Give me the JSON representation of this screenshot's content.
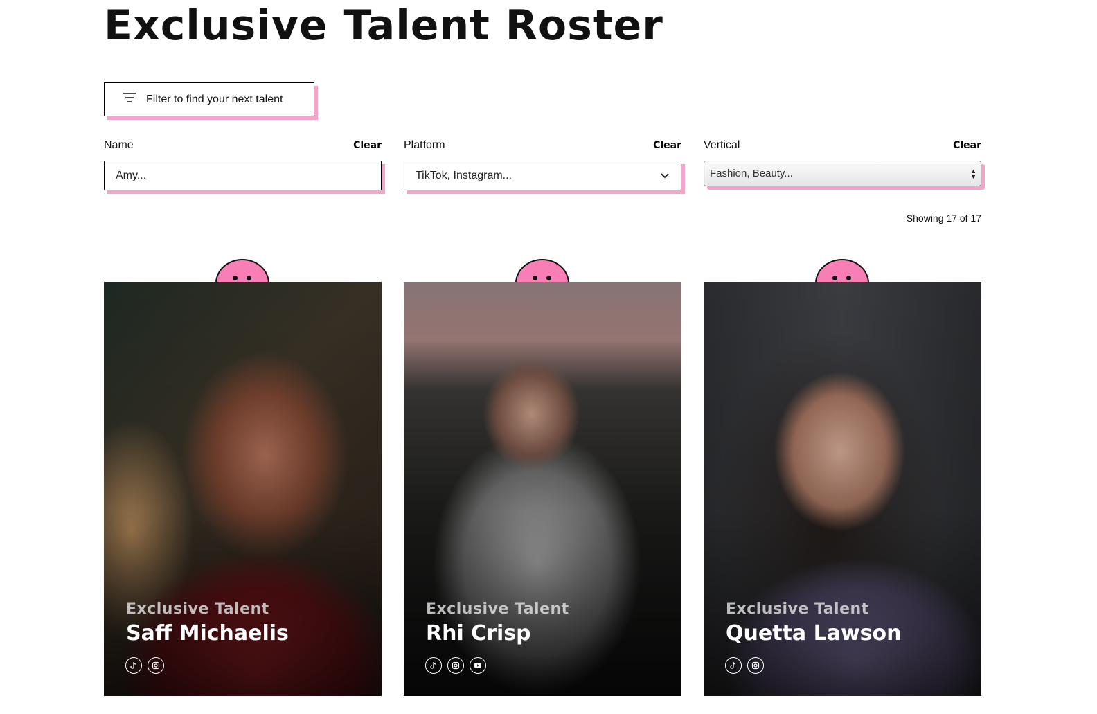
{
  "page": {
    "title": "Exclusive Talent Roster"
  },
  "filter_toggle": {
    "label": "Filter to find your next talent",
    "icon": "filter-icon"
  },
  "filters": {
    "name": {
      "label": "Name",
      "clear": "Clear",
      "placeholder": "Amy..."
    },
    "platform": {
      "label": "Platform",
      "clear": "Clear",
      "placeholder": "TikTok, Instagram..."
    },
    "vertical": {
      "label": "Vertical",
      "clear": "Clear",
      "placeholder": "Fashion, Beauty..."
    }
  },
  "results": {
    "showing": "Showing 17 of 17"
  },
  "colors": {
    "accent_pink": "#f6a3c9",
    "mascot_pink": "#f77fb6"
  },
  "talents": [
    {
      "eyebrow": "Exclusive Talent",
      "name": "Saff Michaelis",
      "socials": [
        "tiktok-icon",
        "instagram-icon"
      ]
    },
    {
      "eyebrow": "Exclusive Talent",
      "name": "Rhi Crisp",
      "socials": [
        "tiktok-icon",
        "instagram-icon",
        "youtube-icon"
      ]
    },
    {
      "eyebrow": "Exclusive Talent",
      "name": "Quetta Lawson",
      "socials": [
        "tiktok-icon",
        "instagram-icon"
      ]
    }
  ]
}
